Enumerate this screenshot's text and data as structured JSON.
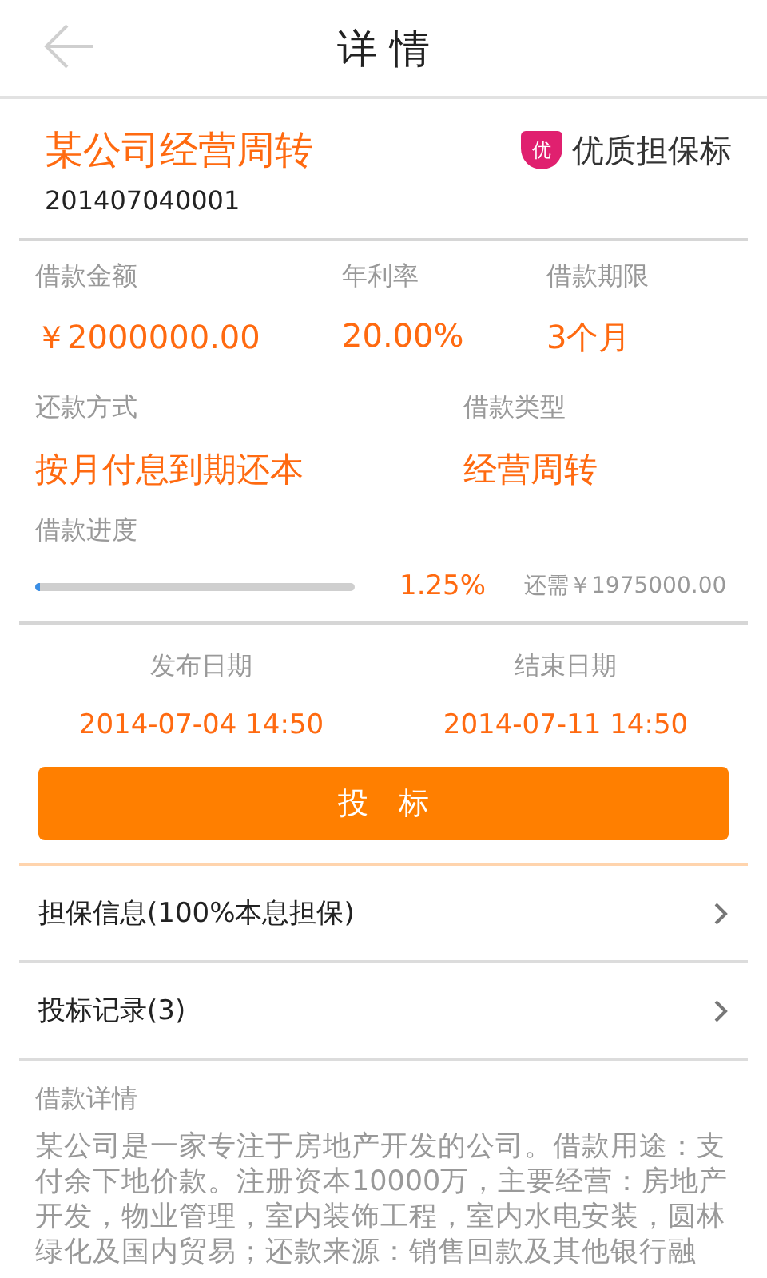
{
  "header": {
    "title": "详 情"
  },
  "loan": {
    "name": "某公司经营周转",
    "badge_icon": "优",
    "badge": "优质担保标",
    "number": "201407040001"
  },
  "stats": [
    {
      "label": "借款金额",
      "value": "￥2000000.00"
    },
    {
      "label": "年利率",
      "value": "20.00%"
    },
    {
      "label": "借款期限",
      "value": "3个月"
    }
  ],
  "stats2": [
    {
      "label": "还款方式",
      "value": "按月付息到期还本"
    },
    {
      "label": "借款类型",
      "value": "经营周转"
    }
  ],
  "progress": {
    "label": "借款进度",
    "level": 0.0125,
    "percent": "1.25%",
    "remaining": "还需￥1975000.00"
  },
  "dates": [
    {
      "label": "发布日期",
      "value": "2014-07-04 14:50"
    },
    {
      "label": "结束日期",
      "value": "2014-07-11 14:50"
    }
  ],
  "bid_button": "投　标",
  "links": [
    {
      "label": "担保信息(100%本息担保)"
    },
    {
      "label": "投标记录(3)"
    }
  ],
  "details": {
    "title": "借款详情",
    "text": "某公司是一家专注于房地产开发的公司。借款用途：支付余下地价款。注册资本10000万，主要经营：房地产开发，物业管理，室内装饰工程，室内水电安装，圆林绿化及国内贸易；还款来源：销售回款及其他银行融"
  }
}
